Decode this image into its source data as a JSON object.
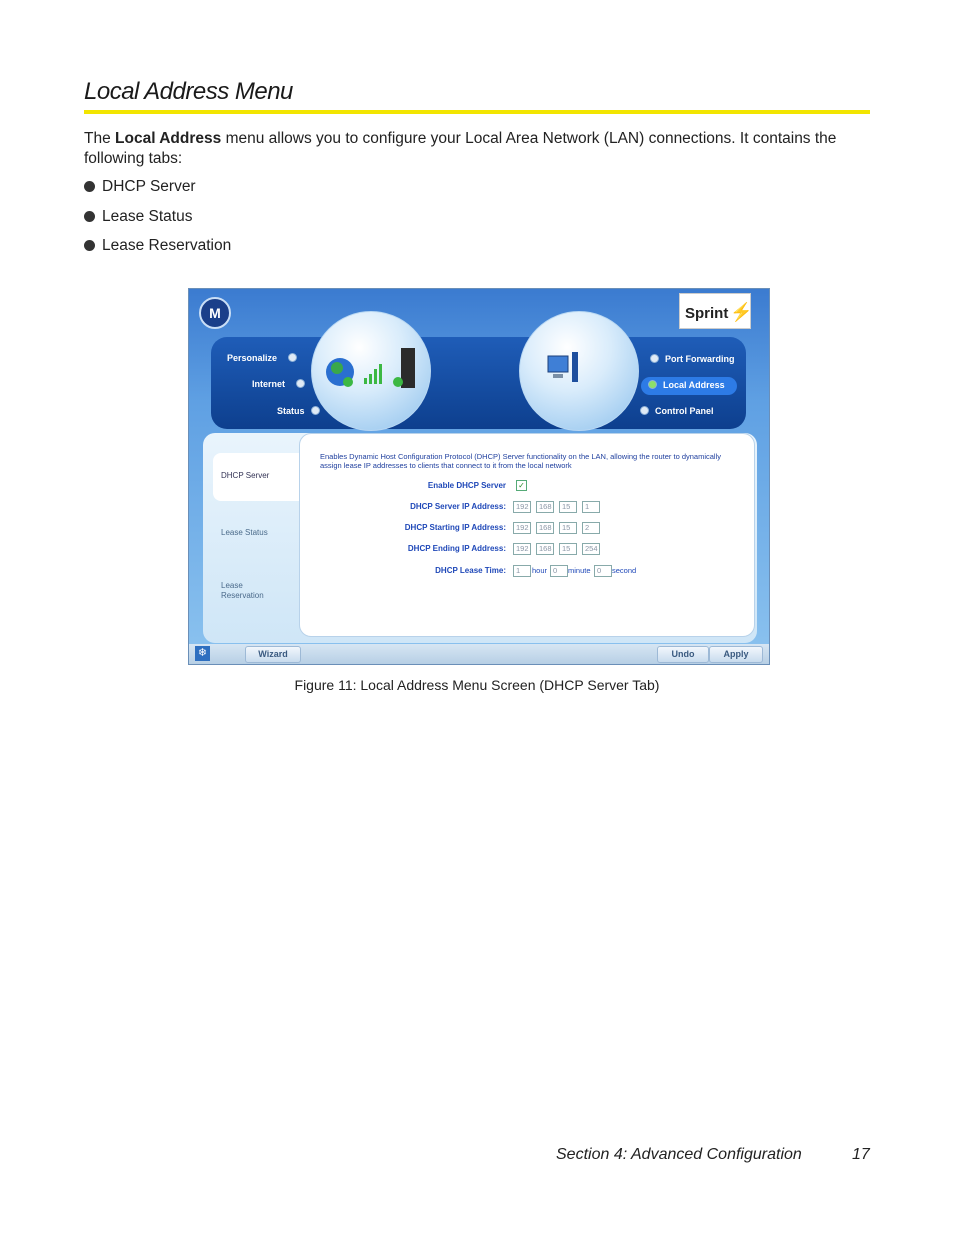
{
  "heading": "Local Address Menu",
  "intro": {
    "before": "The ",
    "bold": "Local Address",
    "after": " menu allows you to configure your Local Area Network (LAN) connections. It contains the following tabs:"
  },
  "bullets": [
    "DHCP Server",
    "Lease Status",
    "Lease Reservation"
  ],
  "screenshot": {
    "logo_left": "M",
    "logo_right": "Sprint",
    "nav_left": [
      "Personalize",
      "Internet",
      "Status"
    ],
    "nav_right": [
      "Port Forwarding",
      "Local Address",
      "Control Panel"
    ],
    "tabs": [
      "DHCP Server",
      "Lease Status",
      "Lease Reservation"
    ],
    "description": "Enables Dynamic Host Configuration Protocol (DHCP) Server functionality on the LAN, allowing the router to dynamically assign lease IP addresses to clients that connect to it from the local network",
    "enable_label": "Enable DHCP Server",
    "server_ip_label": "DHCP Server IP Address:",
    "server_ip": [
      "192",
      "168",
      "15",
      "1"
    ],
    "start_ip_label": "DHCP Starting IP Address:",
    "start_ip": [
      "192",
      "168",
      "15",
      "2"
    ],
    "end_ip_label": "DHCP Ending IP Address:",
    "end_ip": [
      "192",
      "168",
      "15",
      "254"
    ],
    "lease_label": "DHCP Lease Time:",
    "lease_hour": "1",
    "lease_hour_unit": "hour",
    "lease_minute": "0",
    "lease_minute_unit": "minute",
    "lease_second": "0",
    "lease_second_unit": "second",
    "btn_wizard": "Wizard",
    "btn_undo": "Undo",
    "btn_apply": "Apply"
  },
  "caption": "Figure 11: Local Address Menu Screen (DHCP Server Tab)",
  "footer": "Section 4: Advanced Configuration",
  "page_number": "17"
}
